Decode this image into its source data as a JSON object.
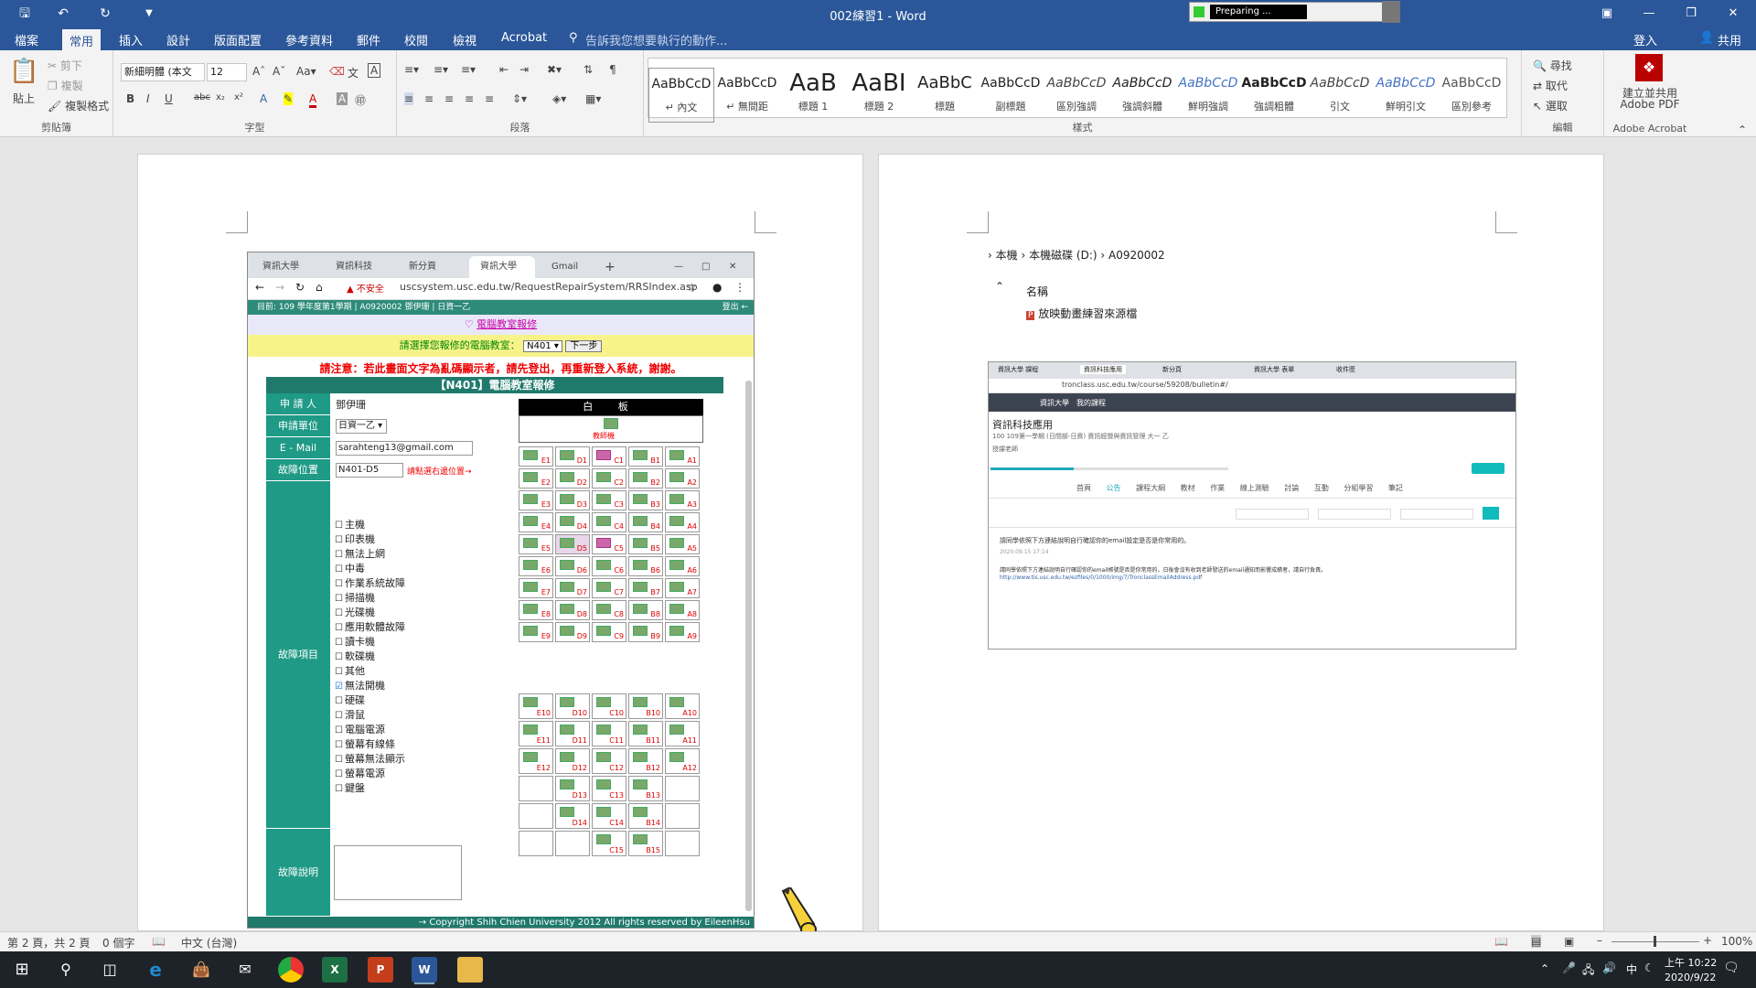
{
  "titlebar": {
    "title": "002練習1 - Word",
    "status_label": "Preparing ..."
  },
  "tabs": {
    "items": [
      "檔案",
      "常用",
      "插入",
      "設計",
      "版面配置",
      "參考資料",
      "郵件",
      "校閱",
      "檢視",
      "Acrobat"
    ],
    "active": "常用",
    "tell_me": "告訴我您想要執行的動作...",
    "signin": "登入",
    "share": "共用"
  },
  "ribbon": {
    "clipboard": {
      "paste": "貼上",
      "cut": "剪下",
      "copy": "複製",
      "format_painter": "複製格式",
      "label": "剪貼簿"
    },
    "font": {
      "name": "新細明體 (本文",
      "size": "12",
      "label": "字型"
    },
    "paragraph": {
      "label": "段落"
    },
    "styles": {
      "label": "樣式",
      "items": [
        {
          "sample": "AaBbCcD",
          "name": "↵ 內文"
        },
        {
          "sample": "AaBbCcD",
          "name": "↵ 無間距"
        },
        {
          "sample": "AaB",
          "name": "標題 1"
        },
        {
          "sample": "AaBI",
          "name": "標題 2"
        },
        {
          "sample": "AaBbC",
          "name": "標題"
        },
        {
          "sample": "AaBbCcD",
          "name": "副標題"
        },
        {
          "sample": "AaBbCcD",
          "name": "區別強調"
        },
        {
          "sample": "AaBbCcD",
          "name": "強調斜體"
        },
        {
          "sample": "AaBbCcD",
          "name": "鮮明強調"
        },
        {
          "sample": "AaBbCcD",
          "name": "強調粗體"
        },
        {
          "sample": "AaBbCcD",
          "name": "引文"
        },
        {
          "sample": "AaBbCcD",
          "name": "鮮明引文"
        },
        {
          "sample": "AaBbCcD",
          "name": "區別參考"
        }
      ]
    },
    "editing": {
      "find": "尋找",
      "replace": "取代",
      "select": "選取",
      "label": "編輯"
    },
    "acrobat": {
      "create": "建立並共用",
      "pdf": "Adobe PDF",
      "label": "Adobe Acrobat"
    }
  },
  "browser1": {
    "tabs": [
      "資訊大學",
      "資訊科技",
      "新分頁",
      "資訊大學",
      "Gmail"
    ],
    "insecure": "不安全",
    "url": "uscsystem.usc.edu.tw/RequestRepairSystem/RRSIndex.asp",
    "sitebar": "目前: 109 學年度第1學期 | A0920002 鄧伊珊 | 日資一乙",
    "logout": "登出 ←",
    "toplink": "電腦教室報修",
    "select_prompt": "請選擇您報修的電腦教室：",
    "room_value": "N401",
    "next_btn": "下一步",
    "notice": "請注意：若此畫面文字為亂碼顯示者，請先登出，再重新登入系統，謝謝。",
    "form_title": "【N401】電腦教室報修",
    "applicant_label": "申 請 人",
    "applicant_value": "鄧伊珊",
    "unit_label": "申請單位",
    "unit_value": "日資一乙",
    "email_label": "E - Mail",
    "email_value": "sarahteng13@gmail.com",
    "location_label": "故障位置",
    "location_value": "N401-D5",
    "location_hint": "請點選右邊位置→",
    "fault_label": "故障項目",
    "desc_label": "故障說明",
    "faults": [
      "主機",
      "印表機",
      "無法上網",
      "中毒",
      "作業系統故障",
      "掃描機",
      "光碟機",
      "應用軟體故障",
      "讀卡機",
      "軟碟機",
      "其他",
      "無法開機",
      "硬碟",
      "滑鼠",
      "電腦電源",
      "螢幕有線條",
      "螢幕無法顯示",
      "螢幕電源",
      "鍵盤"
    ],
    "fault_checked": "無法開機",
    "board": "白 板",
    "teacher": "教師機",
    "copyright": "→ Copyright Shih Chien University 2012 All rights reserved by EileenHsu"
  },
  "explorer": {
    "crumbs": [
      "本機",
      "本機磁碟 (D:)",
      "A0920002"
    ],
    "col": "名稱",
    "file": "放映動畫練習來源檔"
  },
  "browser2": {
    "tabs": [
      "資訊大學 課程",
      "資訊科技應用",
      "新分頁",
      "資訊大學 表單",
      "收件匣"
    ],
    "url": "tronclass.usc.edu.tw/course/59208/bulletin#/",
    "app": "資訊大學",
    "nav": "我的課程",
    "course": "資訊科技應用",
    "course_sub": "100 109第一學期 (日間部-日資) 資訊經營與資訊管理 大一 乙",
    "teacher_lbl": "授課老師",
    "tabs_inner": [
      "首頁",
      "公告",
      "課程大綱",
      "教材",
      "作業",
      "線上測驗",
      "討論",
      "互動",
      "分組學習",
      "筆記"
    ],
    "announce1": "請同學依照下方連結說明自行確認你的email設定是否是你常用的。",
    "date1": "2020.09.15 17:14",
    "announce2": "請同學依照下方連結說明自行確認你的email帳號是否是你常用的，日後會沒有收到老師發送的email通知而影響成績者，請自行負責。",
    "link": "http://www.tis.usc.edu.tw/ezfiles/0/1000/img/7/TronclassEmailAddress.pdf"
  },
  "statusbar": {
    "page": "第 2 頁，共 2 頁",
    "words": "0 個字",
    "lang": "中文 (台灣)",
    "zoom": "100%"
  },
  "taskbar": {
    "time": "上午 10:22",
    "date": "2020/9/22",
    "ime": "中"
  }
}
